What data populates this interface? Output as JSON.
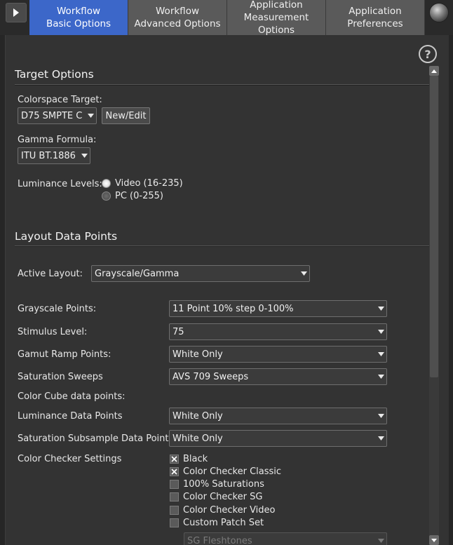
{
  "tabs": [
    {
      "line1": "Workflow",
      "line2": "Basic Options",
      "active": true
    },
    {
      "line1": "Workflow",
      "line2": "Advanced Options",
      "active": false
    },
    {
      "line1": "Application",
      "line2": "Measurement Options",
      "active": false
    },
    {
      "line1": "Application",
      "line2": "Preferences",
      "active": false
    }
  ],
  "help_icon": "?",
  "target_options": {
    "title": "Target Options",
    "colorspace_label": "Colorspace Target:",
    "colorspace_value": "D75 SMPTE C",
    "new_edit_label": "New/Edit",
    "gamma_label": "Gamma Formula:",
    "gamma_value": "ITU BT.1886",
    "luminance_label": "Luminance Levels:",
    "luminance_options": [
      {
        "label": "Video (16-235)",
        "selected": true
      },
      {
        "label": "PC (0-255)",
        "selected": false
      }
    ]
  },
  "layout": {
    "title": "Layout Data Points",
    "active_layout_label": "Active Layout:",
    "active_layout_value": "Grayscale/Gamma",
    "grayscale_label": "Grayscale Points:",
    "grayscale_value": "11 Point 10% step 0-100%",
    "stimulus_label": "Stimulus Level:",
    "stimulus_value": "75",
    "gamut_label": "Gamut Ramp Points:",
    "gamut_value": "White Only",
    "saturation_sweeps_label": "Saturation Sweeps",
    "saturation_sweeps_value": "AVS 709 Sweeps",
    "color_cube_label": "Color Cube data points:",
    "luminance_points_label": "Luminance Data Points",
    "luminance_points_value": "White Only",
    "sat_subsample_label": "Saturation Subsample Data Points",
    "sat_subsample_value": "White Only",
    "checker_label": "Color Checker Settings",
    "checker_items": [
      {
        "label": "Black",
        "checked": true
      },
      {
        "label": "Color Checker Classic",
        "checked": true
      },
      {
        "label": "100% Saturations",
        "checked": false
      },
      {
        "label": "Color Checker SG",
        "checked": false
      },
      {
        "label": "Color Checker Video",
        "checked": false
      },
      {
        "label": "Custom Patch Set",
        "checked": false
      }
    ],
    "patch_set_value": "SG Fleshtones"
  },
  "icons": {
    "nav": "play-arrow-icon",
    "knob": "meter-knob-icon",
    "help": "help-icon",
    "dropdown": "triangle-down-icon",
    "check": "x-mark-icon"
  },
  "colors": {
    "active_tab": "#3c67c9",
    "inactive_tab": "#5a5a5a",
    "panel_bg": "#333333"
  }
}
